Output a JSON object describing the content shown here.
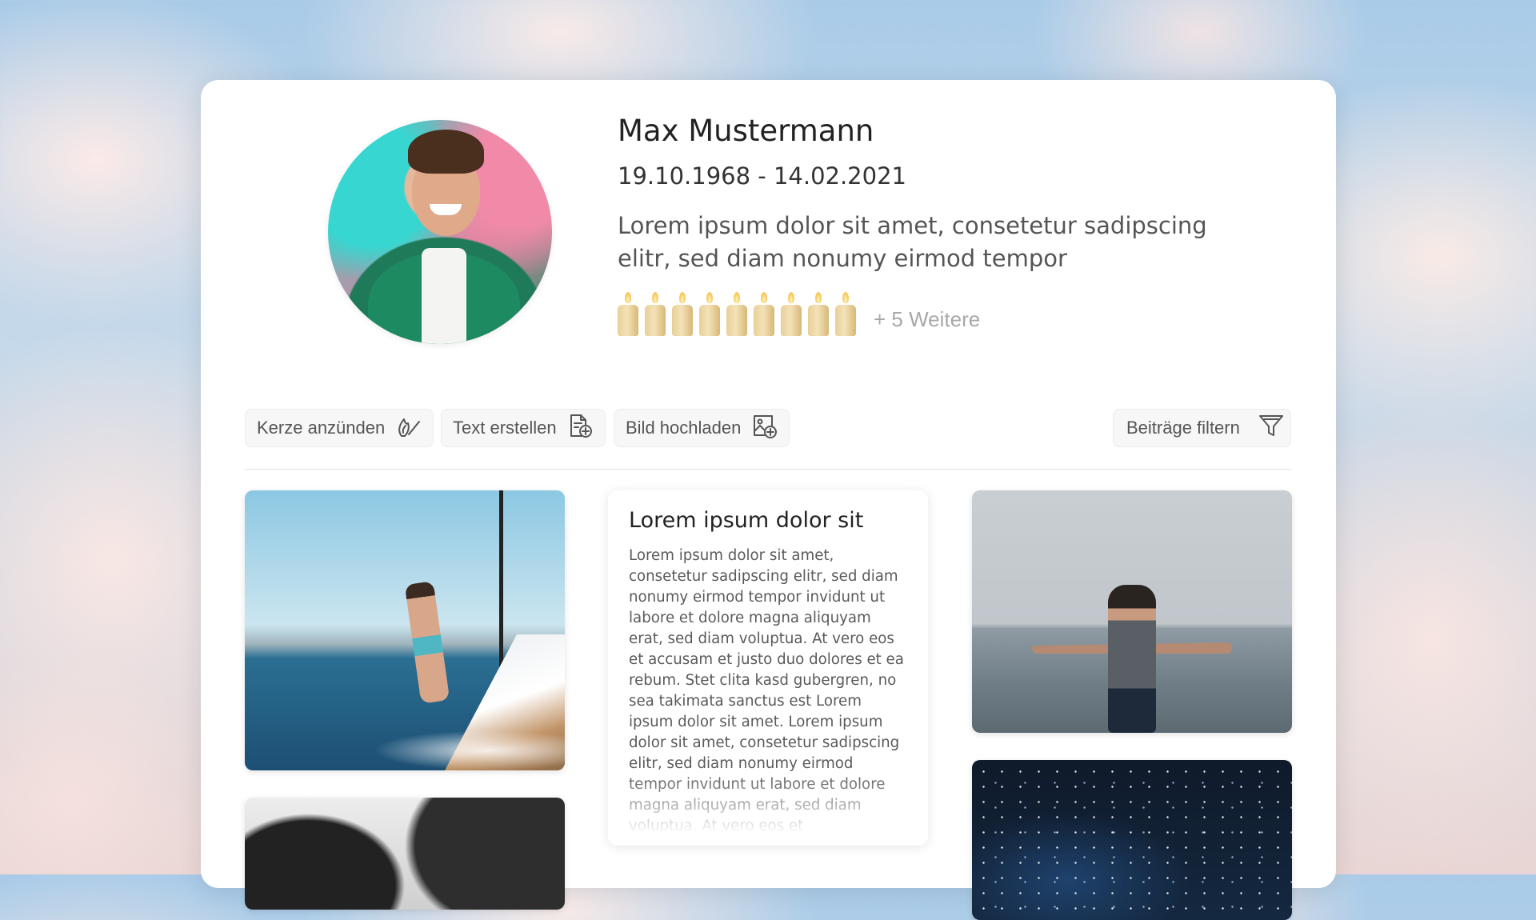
{
  "profile": {
    "name": "Max Mustermann",
    "dates": "19.10.1968 - 14.02.2021",
    "intro": "Lorem ipsum dolor sit amet, consetetur sadipscing elitr, sed diam nonumy eirmod tempor",
    "candle_count_shown": 9,
    "more_candles": "+ 5 Weitere"
  },
  "toolbar": {
    "light_candle": "Kerze anzünden",
    "create_text": "Text erstellen",
    "upload_image": "Bild hochladen",
    "filter_posts": "Beiträge filtern"
  },
  "post": {
    "title": "Lorem ipsum dolor sit",
    "body": "Lorem ipsum dolor sit amet, consetetur sadipscing elitr, sed diam nonumy eirmod tempor invidunt ut labore et dolore magna aliquyam erat, sed diam voluptua. At vero eos et accusam et justo duo dolores et ea rebum. Stet clita kasd gubergren, no sea takimata sanctus est Lorem ipsum dolor sit amet. Lorem ipsum dolor sit amet, consetetur sadipscing elitr, sed diam nonumy eirmod tempor invidunt ut labore et dolore magna aliquyam erat, sed diam voluptua. At vero eos et"
  },
  "icons": {
    "light_candle": "candle-flame-icon",
    "create_text": "document-plus-icon",
    "upload_image": "image-plus-icon",
    "filter_posts": "funnel-icon"
  },
  "colors": {
    "card_background": "#ffffff",
    "button_background": "#f7f7f7",
    "text_primary": "#222222",
    "text_muted": "#a8a8a8"
  }
}
